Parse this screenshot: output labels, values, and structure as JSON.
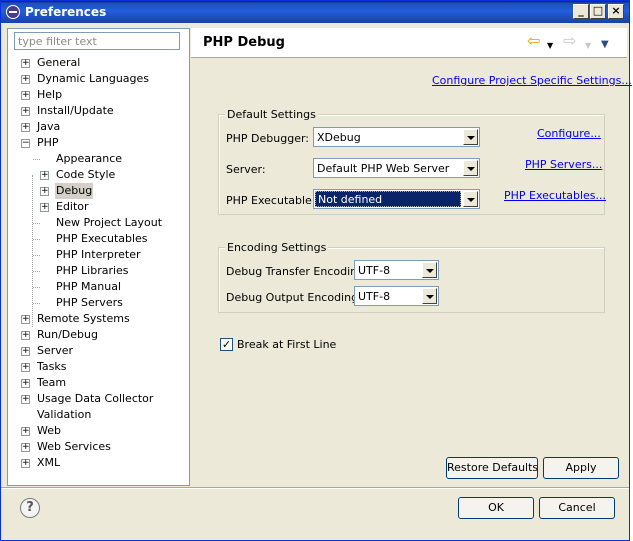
{
  "window": {
    "title": "Preferences"
  },
  "filter": {
    "placeholder": "type filter text"
  },
  "tree": {
    "items": [
      {
        "label": "General",
        "expander": "+"
      },
      {
        "label": "Dynamic Languages",
        "expander": "+"
      },
      {
        "label": "Help",
        "expander": "+"
      },
      {
        "label": "Install/Update",
        "expander": "+"
      },
      {
        "label": "Java",
        "expander": "+"
      },
      {
        "label": "PHP",
        "expander": "−"
      },
      {
        "label": "Appearance",
        "expander": ""
      },
      {
        "label": "Code Style",
        "expander": "+"
      },
      {
        "label": "Debug",
        "expander": "+"
      },
      {
        "label": "Editor",
        "expander": "+"
      },
      {
        "label": "New Project Layout",
        "expander": ""
      },
      {
        "label": "PHP Executables",
        "expander": ""
      },
      {
        "label": "PHP Interpreter",
        "expander": ""
      },
      {
        "label": "PHP Libraries",
        "expander": ""
      },
      {
        "label": "PHP Manual",
        "expander": ""
      },
      {
        "label": "PHP Servers",
        "expander": ""
      },
      {
        "label": "Remote Systems",
        "expander": "+"
      },
      {
        "label": "Run/Debug",
        "expander": "+"
      },
      {
        "label": "Server",
        "expander": "+"
      },
      {
        "label": "Tasks",
        "expander": "+"
      },
      {
        "label": "Team",
        "expander": "+"
      },
      {
        "label": "Usage Data Collector",
        "expander": "+"
      },
      {
        "label": "Validation",
        "expander": ""
      },
      {
        "label": "Web",
        "expander": "+"
      },
      {
        "label": "Web Services",
        "expander": "+"
      },
      {
        "label": "XML",
        "expander": "+"
      }
    ]
  },
  "page": {
    "title": "PHP Debug",
    "configure_project_link": "Configure Project Specific Settings...",
    "default_settings": {
      "title": "Default Settings",
      "debugger_label": "PHP Debugger:",
      "debugger_value": "XDebug",
      "debugger_link": "Configure...",
      "server_label": "Server:",
      "server_value": "Default PHP Web Server",
      "server_link": "PHP Servers...",
      "executable_label": "PHP Executable:",
      "executable_value": "Not defined",
      "executable_link": "PHP Executables..."
    },
    "encoding_settings": {
      "title": "Encoding Settings",
      "transfer_label": "Debug Transfer Encoding",
      "transfer_value": "UTF-8",
      "output_label": "Debug Output Encoding",
      "output_value": "UTF-8"
    },
    "break_first_line": {
      "label": "Break at First Line",
      "checked": true
    },
    "restore_defaults_label": "Restore Defaults",
    "apply_label": "Apply"
  },
  "footer": {
    "help": "?",
    "ok_label": "OK",
    "cancel_label": "Cancel"
  },
  "titlebar_buttons": {
    "minimize": "_",
    "maximize": "□",
    "close": "×"
  },
  "icons": {
    "back": "⇦",
    "forward": "⇨",
    "menu": "▼"
  }
}
